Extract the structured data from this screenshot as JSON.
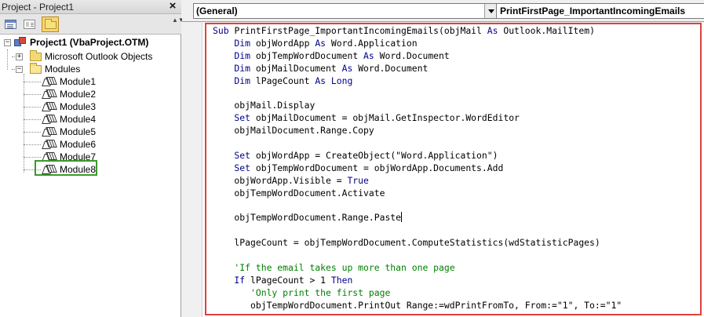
{
  "project_explorer": {
    "title": "Project - Project1",
    "close_glyph": "×",
    "toolbar": {
      "view_code_icon": "view-code-icon",
      "view_object_icon": "view-object-icon",
      "toggle_folders_icon": "folder-icon",
      "scroll_glyph": "▲▼"
    },
    "tree": {
      "project_label": "Project1 (VbaProject.OTM)",
      "outlook_objects_label": "Microsoft Outlook Objects",
      "modules_label": "Modules",
      "modules": [
        "Module1",
        "Module2",
        "Module3",
        "Module4",
        "Module5",
        "Module6",
        "Module7",
        "Module8"
      ],
      "selected_module": "Module8",
      "highlight_color": "#3a9a2a"
    }
  },
  "code_window": {
    "object_dropdown": "(General)",
    "procedure_dropdown": "PrintFirstPage_ImportantIncomingEmails",
    "highlight_color": "#e04040",
    "keyword_color": "#00008b",
    "comment_color": "#008000",
    "lines": [
      [
        {
          "k": "kw",
          "t": "Sub "
        },
        {
          "k": "tx",
          "t": "PrintFirstPage_ImportantIncomingEmails(objMail "
        },
        {
          "k": "kw",
          "t": "As "
        },
        {
          "k": "tx",
          "t": "Outlook.MailItem)"
        }
      ],
      [
        {
          "k": "kw",
          "t": "    Dim "
        },
        {
          "k": "tx",
          "t": "objWordApp "
        },
        {
          "k": "kw",
          "t": "As "
        },
        {
          "k": "tx",
          "t": "Word.Application"
        }
      ],
      [
        {
          "k": "kw",
          "t": "    Dim "
        },
        {
          "k": "tx",
          "t": "objTempWordDocument "
        },
        {
          "k": "kw",
          "t": "As "
        },
        {
          "k": "tx",
          "t": "Word.Document"
        }
      ],
      [
        {
          "k": "kw",
          "t": "    Dim "
        },
        {
          "k": "tx",
          "t": "objMailDocument "
        },
        {
          "k": "kw",
          "t": "As "
        },
        {
          "k": "tx",
          "t": "Word.Document"
        }
      ],
      [
        {
          "k": "kw",
          "t": "    Dim "
        },
        {
          "k": "tx",
          "t": "lPageCount "
        },
        {
          "k": "kw",
          "t": "As Long"
        }
      ],
      [],
      [
        {
          "k": "tx",
          "t": "    objMail.Display"
        }
      ],
      [
        {
          "k": "kw",
          "t": "    Set "
        },
        {
          "k": "tx",
          "t": "objMailDocument = objMail.GetInspector.WordEditor"
        }
      ],
      [
        {
          "k": "tx",
          "t": "    objMailDocument.Range.Copy"
        }
      ],
      [],
      [
        {
          "k": "kw",
          "t": "    Set "
        },
        {
          "k": "tx",
          "t": "objWordApp = CreateObject(\"Word.Application\")"
        }
      ],
      [
        {
          "k": "kw",
          "t": "    Set "
        },
        {
          "k": "tx",
          "t": "objTempWordDocument = objWordApp.Documents.Add"
        }
      ],
      [
        {
          "k": "tx",
          "t": "    objWordApp.Visible = "
        },
        {
          "k": "kw",
          "t": "True"
        }
      ],
      [
        {
          "k": "tx",
          "t": "    objTempWordDocument.Activate"
        }
      ],
      [],
      [
        {
          "k": "tx",
          "t": "    objTempWordDocument.Range.Paste"
        },
        {
          "k": "caret",
          "t": ""
        }
      ],
      [],
      [
        {
          "k": "tx",
          "t": "    lPageCount = objTempWordDocument.ComputeStatistics(wdStatisticPages)"
        }
      ],
      [],
      [
        {
          "k": "cm",
          "t": "    'If the email takes up more than one page"
        }
      ],
      [
        {
          "k": "kw",
          "t": "    If "
        },
        {
          "k": "tx",
          "t": "lPageCount > 1 "
        },
        {
          "k": "kw",
          "t": "Then"
        }
      ],
      [
        {
          "k": "cm",
          "t": "       'Only print the first page"
        }
      ],
      [
        {
          "k": "tx",
          "t": "       objTempWordDocument.PrintOut Range:=wdPrintFromTo, From:=\"1\", To:=\"1\""
        }
      ]
    ]
  }
}
